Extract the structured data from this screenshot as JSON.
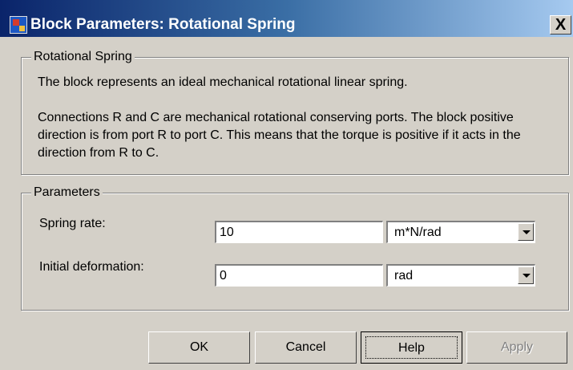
{
  "window": {
    "title": "Block Parameters: Rotational Spring",
    "close_label": "X"
  },
  "description": {
    "legend": "Rotational Spring",
    "line1": "The block represents an ideal mechanical rotational linear spring.",
    "line2": "Connections R and C are mechanical rotational conserving ports. The block positive",
    "line3": "direction is from port R to port C. This means that the torque is positive if it acts in the",
    "line4": "direction from R to C."
  },
  "parameters": {
    "legend": "Parameters",
    "spring_rate": {
      "label": "Spring rate:",
      "value": "10",
      "unit": "m*N/rad"
    },
    "initial_deformation": {
      "label": "Initial deformation:",
      "value": "0",
      "unit": "rad"
    }
  },
  "buttons": {
    "ok": "OK",
    "cancel": "Cancel",
    "help": "Help",
    "apply": "Apply"
  }
}
